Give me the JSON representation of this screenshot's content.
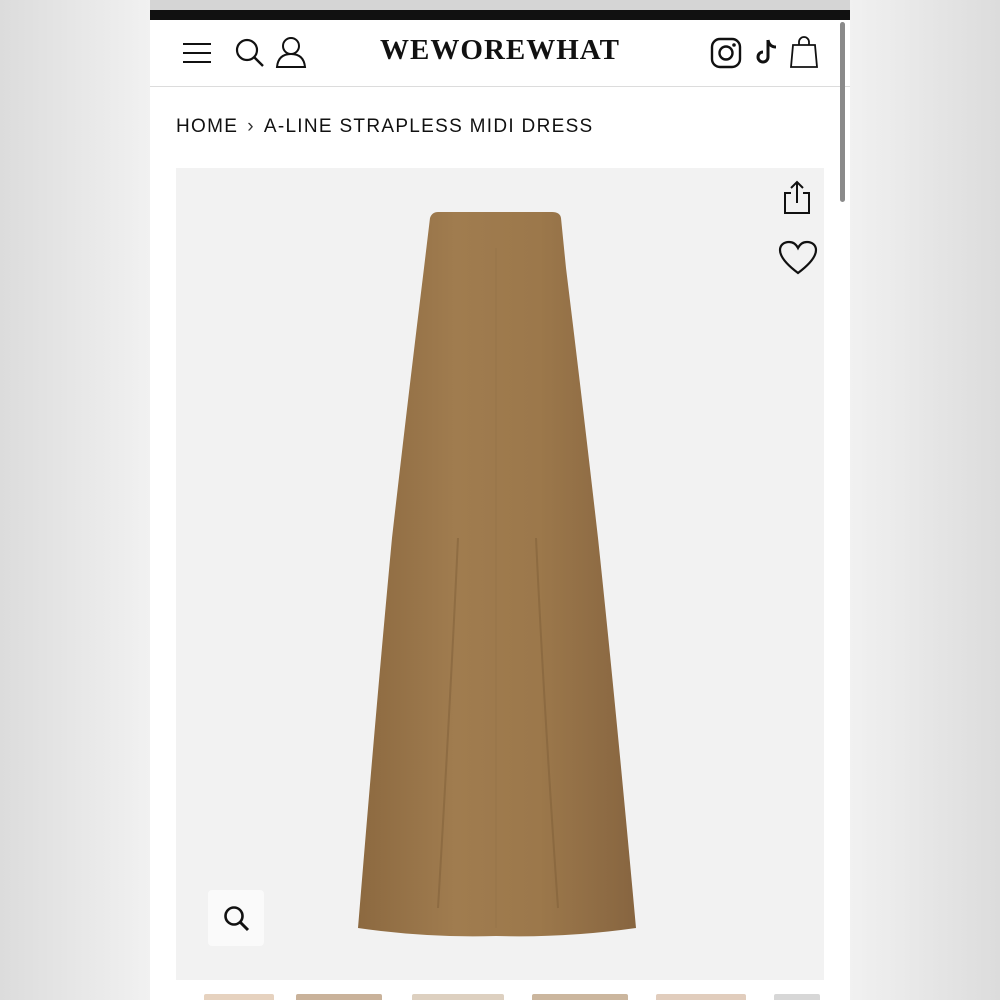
{
  "header": {
    "logo": "WEWOREWHAT",
    "icons": [
      "menu-icon",
      "search-icon",
      "account-icon",
      "instagram-icon",
      "tiktok-icon",
      "bag-icon"
    ]
  },
  "breadcrumb": {
    "home": "HOME",
    "separator": "›",
    "current": "A-LINE STRAPLESS MIDI DRESS"
  },
  "product": {
    "image": "dress-image",
    "dress_color": "#9a7548",
    "actions": [
      "share-icon",
      "heart-icon",
      "zoom-icon"
    ]
  }
}
